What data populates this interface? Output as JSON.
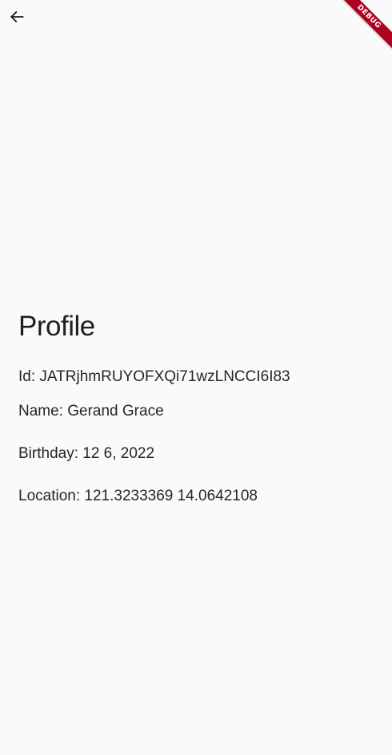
{
  "app_bar": {
    "back_icon": "arrow-back-icon"
  },
  "debug_banner": {
    "label": "DEBUG",
    "color": "#b00020"
  },
  "profile": {
    "title": "Profile",
    "id_text": "Id: JATRjhmRUYOFXQi71wzLNCCI6I83",
    "name_text": "Name: Gerand Grace",
    "birthday_text": "Birthday: 12 6, 2022",
    "location_text": "Location: 121.3233369 14.0642108"
  }
}
